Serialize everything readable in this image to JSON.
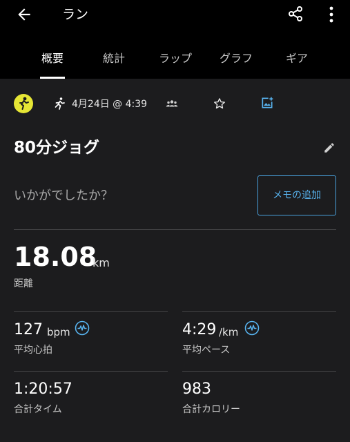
{
  "header": {
    "title": "ラン"
  },
  "tabs": [
    {
      "label": "概要",
      "active": true
    },
    {
      "label": "統計",
      "active": false
    },
    {
      "label": "ラップ",
      "active": false
    },
    {
      "label": "グラフ",
      "active": false
    },
    {
      "label": "ギア",
      "active": false
    }
  ],
  "activity": {
    "date": "4月24日 @ 4:39",
    "name": "80分ジョグ",
    "prompt": "いかがでしたか？",
    "memo_button": "メモの追加"
  },
  "distance": {
    "value": "18.08",
    "unit": "km",
    "label": "距離"
  },
  "metrics": {
    "avg_hr": {
      "value": "127",
      "unit": "bpm",
      "label": "平均心拍"
    },
    "avg_pace": {
      "value": "4:29",
      "unit": "/km",
      "label": "平均ペース"
    },
    "total_time": {
      "value": "1:20:57",
      "label": "合計タイム"
    },
    "calories": {
      "value": "983",
      "label": "合計カロリー"
    }
  },
  "colors": {
    "accent": "#58b4f0",
    "avatar": "#e6e635",
    "background": "#1c1c1e",
    "header": "#000000"
  }
}
